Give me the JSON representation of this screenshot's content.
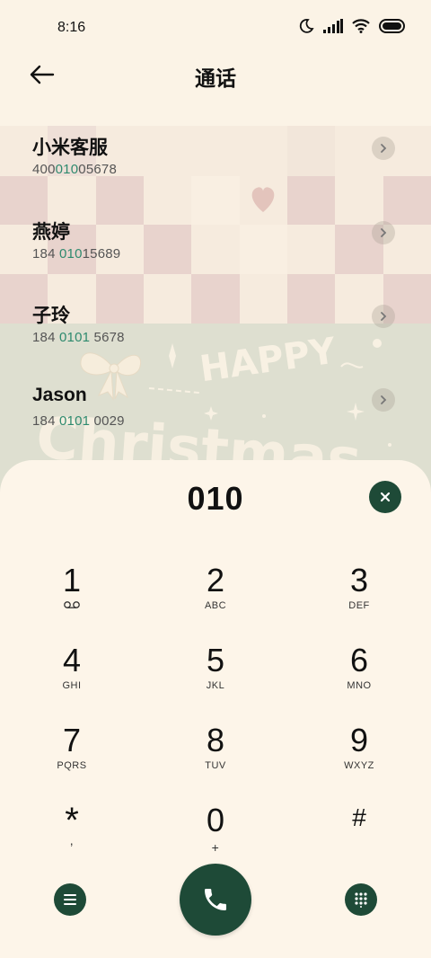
{
  "status_bar": {
    "time": "8:16"
  },
  "header": {
    "title": "通话"
  },
  "contacts": [
    {
      "name": "小米客服",
      "num_pre": "400",
      "num_hl": "010",
      "num_post": "05678"
    },
    {
      "name": "燕婷",
      "num_pre": "184 ",
      "num_hl": "010",
      "num_post": "15689"
    },
    {
      "name": "子玲",
      "num_pre": "184 ",
      "num_hl": "0101",
      "num_post": " 5678"
    },
    {
      "name": "Jason",
      "num_pre": "184 ",
      "num_hl": "0101",
      "num_post": " 0029"
    }
  ],
  "background": {
    "happy_text": "HAPPY",
    "christmas_text": "Christmas"
  },
  "dialer": {
    "input_value": "010",
    "keys": [
      {
        "digit": "1",
        "letters": ""
      },
      {
        "digit": "2",
        "letters": "ABC"
      },
      {
        "digit": "3",
        "letters": "DEF"
      },
      {
        "digit": "4",
        "letters": "GHI"
      },
      {
        "digit": "5",
        "letters": "JKL"
      },
      {
        "digit": "6",
        "letters": "MNO"
      },
      {
        "digit": "7",
        "letters": "PQRS"
      },
      {
        "digit": "8",
        "letters": "TUV"
      },
      {
        "digit": "9",
        "letters": "WXYZ"
      },
      {
        "digit": "*",
        "letters": ","
      },
      {
        "digit": "0",
        "letters": "+"
      },
      {
        "digit": "#",
        "letters": ""
      }
    ]
  },
  "icons": {
    "back": "arrow-left-icon",
    "clear": "close-icon",
    "menu": "menu-icon",
    "call": "phone-icon",
    "keypad": "dialpad-icon",
    "voicemail": "voicemail-icon"
  },
  "colors": {
    "accent": "#1e4a37",
    "highlight": "#2e8a6e",
    "background": "#fbf3e6",
    "checker_pink": "#e8d2cc",
    "sage": "#dedfd0"
  }
}
